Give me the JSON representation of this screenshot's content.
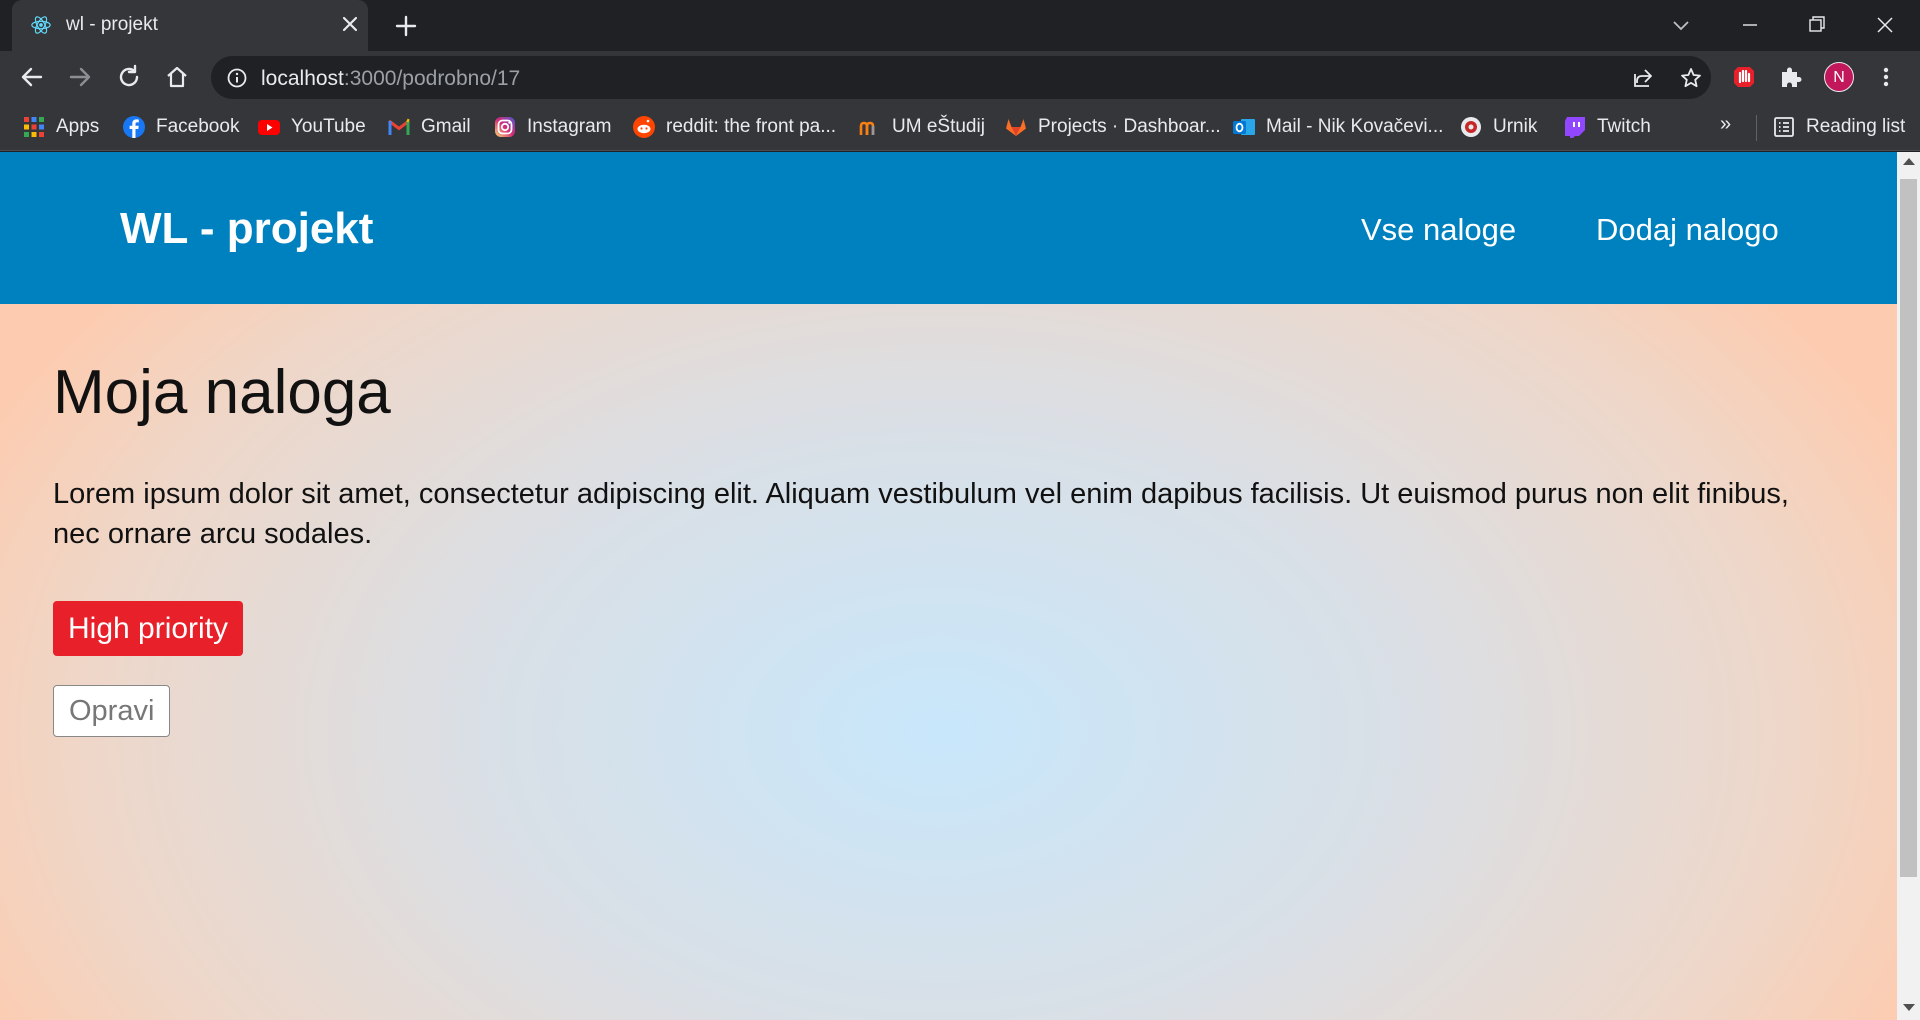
{
  "browser": {
    "tab": {
      "title": "wl - projekt",
      "favicon": "react-atom-icon"
    },
    "address": {
      "host": "localhost",
      "path": ":3000/podrobno/17"
    },
    "profile_initial": "N",
    "bookmarks": [
      {
        "label": "Apps",
        "icon": "apps-grid-icon"
      },
      {
        "label": "Facebook",
        "icon": "facebook-icon"
      },
      {
        "label": "YouTube",
        "icon": "youtube-icon"
      },
      {
        "label": "Gmail",
        "icon": "gmail-icon"
      },
      {
        "label": "Instagram",
        "icon": "instagram-icon"
      },
      {
        "label": "reddit: the front pa...",
        "icon": "reddit-icon"
      },
      {
        "label": "UM eŠtudij",
        "icon": "um-estudij-icon"
      },
      {
        "label": "Projects · Dashboar...",
        "icon": "gitlab-icon"
      },
      {
        "label": "Mail - Nik Kovačevi...",
        "icon": "outlook-icon"
      },
      {
        "label": "Urnik",
        "icon": "urnik-icon"
      },
      {
        "label": "Twitch",
        "icon": "twitch-icon"
      }
    ],
    "bookmarks_more": "»",
    "reading_list": "Reading list"
  },
  "app": {
    "brand": "WL - projekt",
    "nav": {
      "all_tasks": "Vse naloge",
      "add_task": "Dodaj nalogo"
    },
    "task": {
      "title": "Moja naloga",
      "description": "Lorem ipsum dolor sit amet, consectetur adipiscing elit. Aliquam vestibulum vel enim dapibus facilisis. Ut euismod purus non elit finibus, nec ornare arcu sodales.",
      "priority": "High priority",
      "edit_label": "Opravi"
    }
  },
  "colors": {
    "navbar": "#0081bf",
    "priority_badge": "#e8202a",
    "chrome_dark": "#202124",
    "chrome_toolbar": "#35363a"
  }
}
